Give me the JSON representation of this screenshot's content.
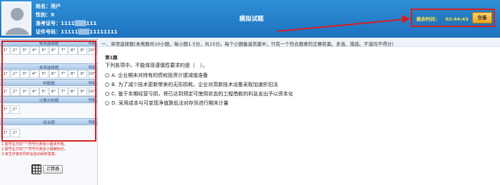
{
  "header": {
    "name_line": "姓名：用户",
    "gender_line": "性别：X",
    "admission_line": "准考证号：1111▒▒▒111",
    "id_line": "证件号码：11111▒▒▒11111111",
    "exam_title": "模拟试题",
    "timer_label": "剩余时间：",
    "timer_value": "02:44:43",
    "submit_label": "交卷"
  },
  "sidebar": {
    "sections": [
      {
        "name": "单项选择题",
        "toggle": "收起",
        "numbers": [
          "1°",
          "2°",
          "3°",
          "4°",
          "5°",
          "6°",
          "7°",
          "8°",
          "9°",
          "10°"
        ]
      },
      {
        "name": "多项选择题",
        "toggle": "收起",
        "numbers": [
          "1°",
          "2°",
          "3°",
          "4°",
          "5°",
          "6°",
          "7°",
          "8°",
          "9°",
          "10°"
        ]
      },
      {
        "name": "判断题",
        "toggle": "收起",
        "numbers": [
          "1°",
          "2°",
          "3°",
          "4°",
          "5°",
          "6°",
          "7°",
          "8°",
          "9°",
          "10°"
        ]
      },
      {
        "name": "计算分析题",
        "toggle": "收起",
        "numbers": [
          "1°",
          "2°"
        ]
      },
      {
        "name": "综合题",
        "toggle": "收起",
        "numbers": [
          "1°",
          "2°"
        ]
      }
    ],
    "notes": [
      "1.题号右方的“°”符号代表该小题未作答。",
      "2.题号右方的“?”符号代表该小题被标记。",
      "3.考生作答时同时会自动保存答案。"
    ],
    "calculator_label": "计算器"
  },
  "main": {
    "instruction": "一、单项选择题(本类题共10小题，每小题1.5分，共15分。每个小题备选答案中，只有一个符合题意的正确答案。多选、错选、不选均不得分)",
    "question_number": "第1题",
    "question_stem": "下列各项中，不能体现谨慎性要求的是（　）。",
    "options": [
      "A. 企业期末对持有的债权投资计提减值准备",
      "B. 为了减少技术更新带来的无形损耗，企业对高新技术设备采取加速折旧法",
      "C. 鉴于本期经营亏损，将已达到预定可使用状态的工程借款的利息支出予以资本化",
      "D. 采用成本与可变现净值孰低法对存货进行期末计量"
    ]
  },
  "colors": {
    "header_blue": "#1d72bf",
    "annotation_red": "#d62020",
    "timer_yellow": "#ffe14a",
    "submit_orange": "#f2a61c"
  },
  "icons": [
    "avatar-silhouette-icon",
    "calculator-icon",
    "radio-icon",
    "arrow-annotation-icon"
  ]
}
